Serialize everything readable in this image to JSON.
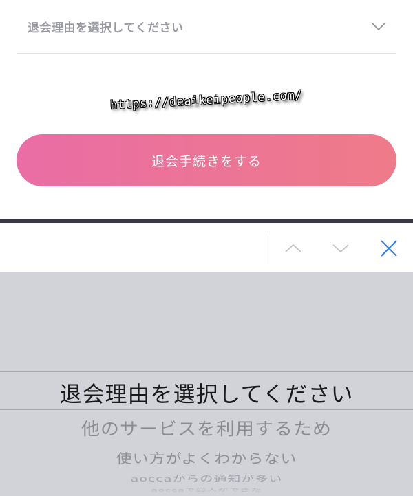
{
  "web": {
    "select_placeholder": "退会理由を選択してください",
    "watermark": "https://deaikeipeople.com/",
    "submit_label": "退会手続きをする"
  },
  "toolbar": {
    "icons": [
      "chevron-up-icon",
      "chevron-down-icon",
      "close-icon"
    ],
    "accent": "#2f7cf6"
  },
  "picker": {
    "options": [
      "退会理由を選択してください",
      "他のサービスを利用するため",
      "使い方がよくわからない",
      "aoccaからの通知が多い",
      "aoccaで恋人ができた"
    ]
  },
  "colors": {
    "button_gradient_start": "#ea6da5",
    "button_gradient_end": "#ee7b89",
    "picker_bg": "#d1d3d9"
  }
}
